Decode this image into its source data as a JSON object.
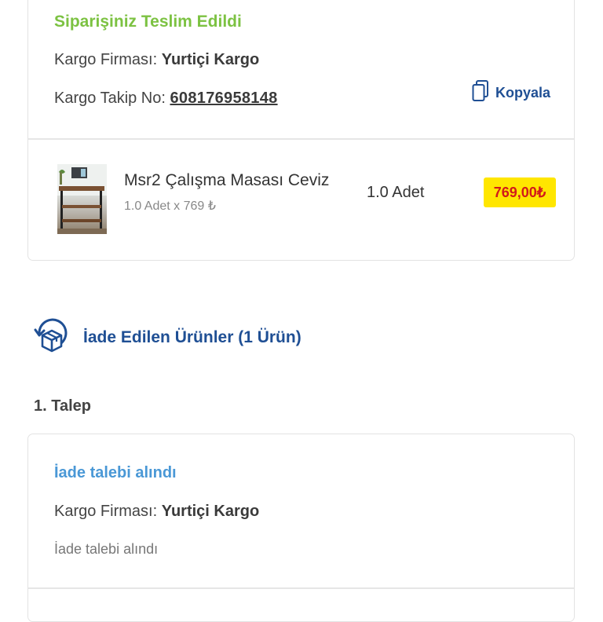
{
  "delivery": {
    "status": "Siparişiniz Teslim Edildi",
    "status_color": "#7cc242",
    "carrier_label": "Kargo Firması:",
    "carrier_value": "Yurtiçi Kargo",
    "tracking_label": "Kargo Takip No:",
    "tracking_value": "608176958148",
    "copy_label": "Kopyala",
    "copy_icon": "copy-icon"
  },
  "product": {
    "name": "Msr2 Çalışma Masası Ceviz",
    "sub": "1.0 Adet x 769 ₺",
    "quantity": "1.0 Adet",
    "price": "769,00₺",
    "image": "desk-product-image"
  },
  "returns": {
    "icon": "return-box-icon",
    "title": "İade Edilen Ürünler (1 Ürün)",
    "request_label": "1. Talep",
    "status": "İade talebi alındı",
    "status_color": "#4a98d6",
    "carrier_label": "Kargo Firması:",
    "carrier_value": "Yurtiçi Kargo",
    "note": "İade talebi alındı"
  },
  "colors": {
    "accent_blue": "#1f4f94",
    "price_badge_bg": "#ffe600",
    "price_text": "#d21a1a"
  }
}
